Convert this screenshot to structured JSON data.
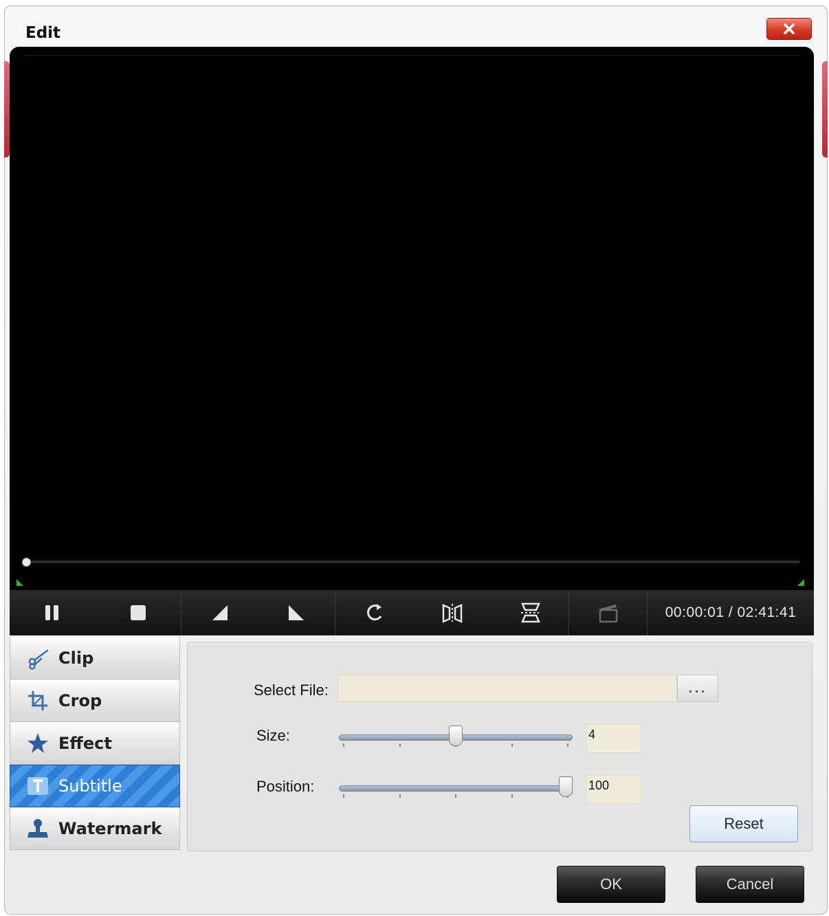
{
  "window": {
    "title": "Edit"
  },
  "player": {
    "time_display": "00:00:01 / 02:41:41",
    "progress": 0.0
  },
  "tabs": [
    {
      "label": "Clip",
      "icon": "scissors-icon",
      "active": false
    },
    {
      "label": "Crop",
      "icon": "crop-icon",
      "active": false
    },
    {
      "label": "Effect",
      "icon": "star-icon",
      "active": false
    },
    {
      "label": "Subtitle",
      "icon": "subtitle-icon",
      "active": true
    },
    {
      "label": "Watermark",
      "icon": "stamp-icon",
      "active": false
    }
  ],
  "subtitle_panel": {
    "select_file_label": "Select File:",
    "select_file_value": "",
    "browse_label": "...",
    "size_label": "Size:",
    "size_value": "4",
    "size_fraction": 0.5,
    "position_label": "Position:",
    "position_value": "100",
    "position_fraction": 1.0,
    "reset_label": "Reset"
  },
  "footer": {
    "ok_label": "OK",
    "cancel_label": "Cancel"
  },
  "colors": {
    "accent_active_tab": "#3a8ae0",
    "close_button": "#d43a26",
    "timeline_marker": "#2fb03a"
  }
}
